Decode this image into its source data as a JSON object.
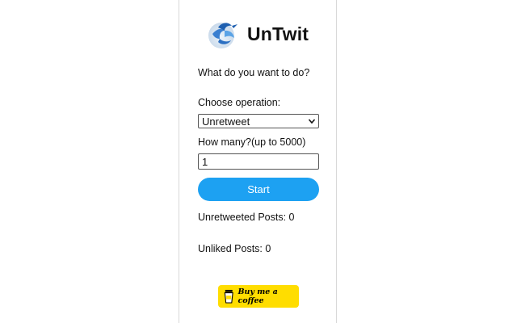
{
  "app": {
    "title": "UnTwit",
    "logo_icon": "bird-logo-icon"
  },
  "main": {
    "question": "What do you want to do?",
    "operation": {
      "label": "Choose operation:",
      "selected": "Unretweet"
    },
    "count": {
      "label": "How many?(up to 5000)",
      "value": "1"
    },
    "start_label": "Start",
    "stats": {
      "unretweeted": "Unretweeted Posts: 0",
      "unliked": "Unliked Posts: 0"
    }
  },
  "support": {
    "coffee_label": "Buy me a coffee",
    "coffee_icon": "coffee-cup-icon"
  },
  "colors": {
    "accent": "#1da1f2",
    "coffee": "#ffdd00"
  }
}
